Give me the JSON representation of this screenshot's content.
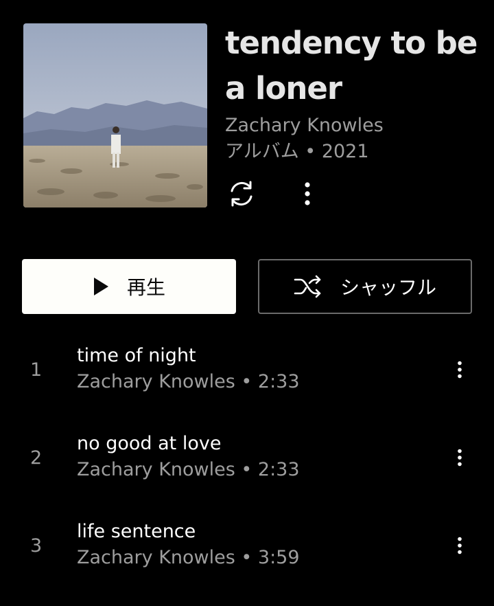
{
  "album": {
    "title_line1": "tendency to be",
    "title_line2": "a loner",
    "artist": "Zachary Knowles",
    "meta": "アルバム • 2021"
  },
  "actions": {
    "play_label": "再生",
    "shuffle_label": "シャッフル"
  },
  "icons": {
    "library": "sync-arrows-icon",
    "more": "more-vert-icon",
    "play": "play-icon",
    "shuffle": "shuffle-icon"
  },
  "tracks": [
    {
      "num": "1",
      "title": "time of night",
      "sub": "Zachary Knowles • 2:33"
    },
    {
      "num": "2",
      "title": "no good at love",
      "sub": "Zachary Knowles • 2:33"
    },
    {
      "num": "3",
      "title": "life sentence",
      "sub": "Zachary Knowles • 3:59"
    }
  ],
  "colors": {
    "background": "#000000",
    "secondary_text": "#9e9e9e",
    "play_button": "#fefefa"
  }
}
